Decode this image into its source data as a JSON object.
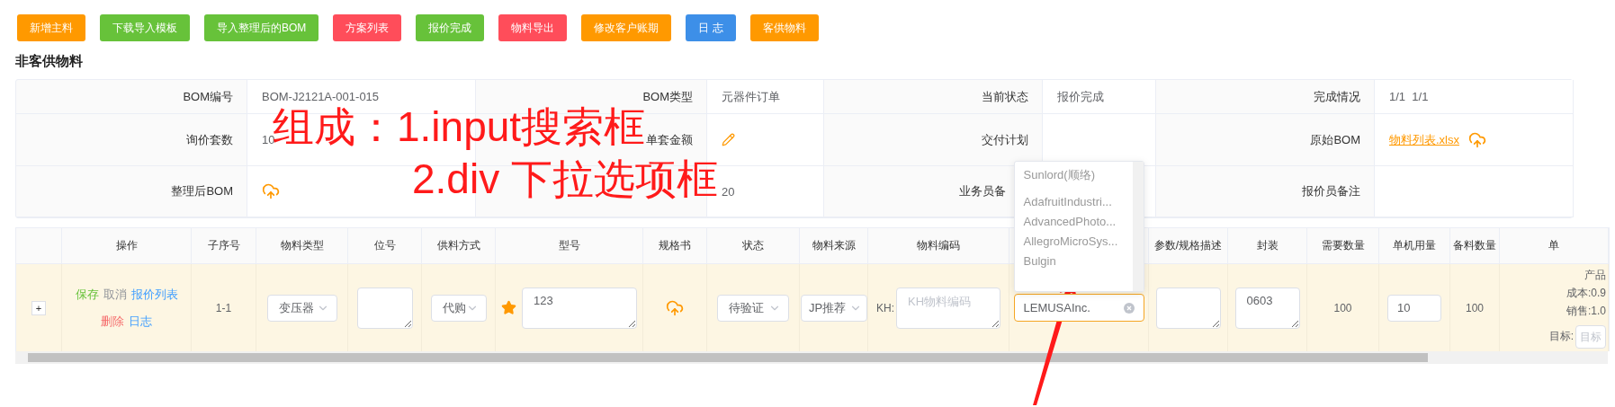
{
  "toolbar": {
    "buttons": [
      {
        "label": "新增主料",
        "color": "#ff9900"
      },
      {
        "label": "下载导入模板",
        "color": "#67c23a"
      },
      {
        "label": "导入整理后的BOM",
        "color": "#67c23a"
      },
      {
        "label": "方案列表",
        "color": "#ff4d5a"
      },
      {
        "label": "报价完成",
        "color": "#67c23a"
      },
      {
        "label": "物料导出",
        "color": "#ff4d5a"
      },
      {
        "label": "修改客户账期",
        "color": "#ff9900"
      },
      {
        "label": "日 志",
        "color": "#3d8fe8"
      },
      {
        "label": "客供物料",
        "color": "#ff9900"
      }
    ]
  },
  "section_title": "非客供物料",
  "info": {
    "rows": [
      [
        {
          "label": "BOM编号",
          "kind": "text",
          "value": "BOM-J2121A-001-015"
        },
        {
          "label": "BOM类型",
          "kind": "text",
          "value": "元器件订单"
        },
        {
          "label": "当前状态",
          "kind": "text",
          "value": "报价完成"
        },
        {
          "label": "完成情况",
          "kind": "text",
          "value": "1/1  1/1"
        }
      ],
      [
        {
          "label": "询价套数",
          "kind": "text",
          "value": "10"
        },
        {
          "label": "单套金额",
          "kind": "edit"
        },
        {
          "label": "交付计划",
          "kind": "empty"
        },
        {
          "label": "原始BOM",
          "kind": "link",
          "value": "物料列表.xlsx"
        }
      ],
      [
        {
          "label": "整理后BOM",
          "kind": "upload"
        },
        {
          "kind": "text",
          "value": "20"
        },
        {
          "label": "业务员备",
          "kind": "empty",
          "truncated": true
        },
        {
          "label": "报价员备注",
          "kind": "empty"
        }
      ]
    ]
  },
  "grid": {
    "columns": [
      {
        "kind": "blank"
      },
      {
        "kind": "text",
        "label": "操作"
      },
      {
        "kind": "text",
        "label": "子序号"
      },
      {
        "kind": "text",
        "label": "物料类型"
      },
      {
        "kind": "text",
        "label": "位号"
      },
      {
        "kind": "text",
        "label": "供料方式"
      },
      {
        "kind": "text",
        "label": "型号"
      },
      {
        "kind": "text",
        "label": "规格书"
      },
      {
        "kind": "text",
        "label": "状态"
      },
      {
        "kind": "text",
        "label": "物料来源"
      },
      {
        "kind": "text",
        "label": "物料编码"
      },
      {
        "kind": "blank"
      },
      {
        "kind": "text",
        "label": "参数/规格描述"
      },
      {
        "kind": "text",
        "label": "封装"
      },
      {
        "kind": "text",
        "label": "需要数量"
      },
      {
        "kind": "text",
        "label": "单机用量"
      },
      {
        "kind": "text",
        "label": "备料数量"
      },
      {
        "kind": "text",
        "label": "单"
      }
    ],
    "row": {
      "expand": "+",
      "actions": [
        [
          {
            "label": "保存",
            "color": "#67c23a"
          },
          {
            "label": "取消",
            "color": "#909399"
          },
          {
            "label": "报价列表",
            "color": "#409eff"
          }
        ],
        [
          {
            "label": "删除",
            "color": "#f56c6c"
          },
          {
            "label": "日志",
            "color": "#409eff"
          }
        ]
      ],
      "index": "1-1",
      "material_type": "变压器",
      "supply_mode": "代购",
      "model": "123",
      "status": "待验证",
      "source": "JP推荐",
      "code_prefix": "KH:",
      "code_placeholder": "KH物料编码",
      "brand": {
        "value": "LEMUSAInc.",
        "focused": true,
        "options": [
          "Sunlord(顺络)",
          "AdafruitIndustri...",
          "AdvancedPhoto...",
          "AllegroMicroSys...",
          "Bulgin"
        ]
      },
      "package": "0603",
      "required_qty": "100",
      "unit_usage": "10",
      "spare_qty": "100",
      "price": {
        "lines": [
          "产品",
          "成本:0.9",
          "销售:1.0"
        ],
        "target_label": "目标:",
        "target_placeholder": "目标"
      }
    }
  },
  "annotation": {
    "lines": [
      "组成：1.input搜索框",
      "2.div 下拉选项框"
    ]
  }
}
